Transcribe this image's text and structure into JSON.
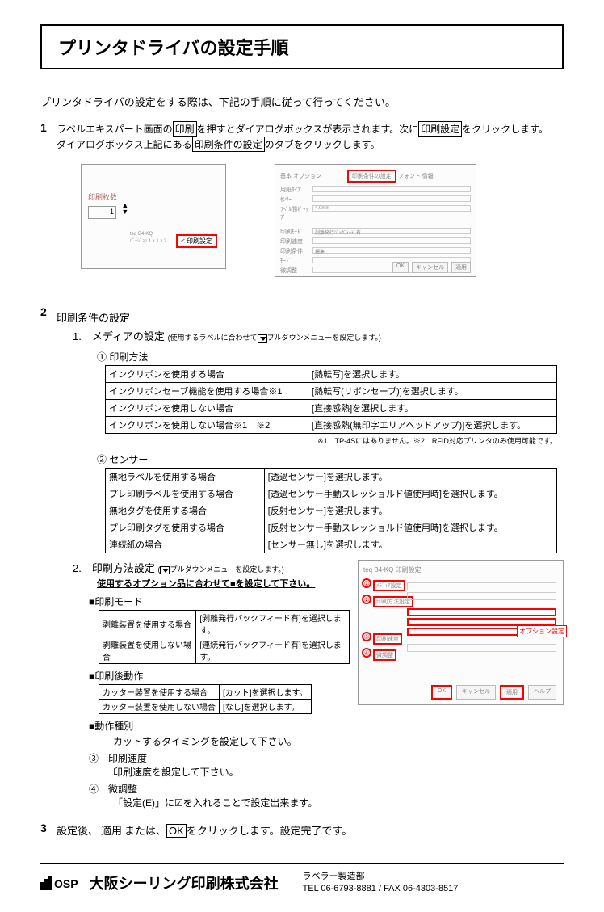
{
  "title": "プリンタドライバの設定手順",
  "intro": "プリンタドライバの設定をする際は、下記の手順に従って行ってください。",
  "step1": {
    "num": "1",
    "t1a": "ラベルエキスパート画面の",
    "t1b": "印刷",
    "t1c": "を押すとダイアログボックスが表示されます。次に",
    "t1d": "印刷設定",
    "t1e": "をクリックします。",
    "t2a": "ダイアログボックス上記にある",
    "t2b": "印刷条件の設定",
    "t2c": "のタブをクリックします。"
  },
  "shot_left": {
    "label": "印刷枚数",
    "value": "1",
    "btn": "< 印刷設定"
  },
  "shot_right": {
    "tab": "印刷条件の設定",
    "ok": "OK",
    "cancel": "キャンセル",
    "apply": "適用"
  },
  "step2": {
    "num": "2",
    "head": "印刷条件の設定",
    "sub1_head": "1.　メディアの設定",
    "sub1_note_a": "(使用するラベルに合わせて",
    "sub1_note_b": "プルダウンメニューを設定します。)",
    "c1": "① 印刷方法",
    "t1": [
      [
        "インクリボンを使用する場合",
        "[熱転写]を選択します。"
      ],
      [
        "インクリボンセーブ機能を使用する場合※1",
        "[熱転写(リボンセーブ)]を選択します。"
      ],
      [
        "インクリボンを使用しない場合",
        "[直接感熱]を選択します。"
      ],
      [
        "インクリボンを使用しない場合※1　※2",
        "[直接感熱(無印字エリアヘッドアップ)]を選択します。"
      ]
    ],
    "t1_note": "※1　TP-4Sにはありません。※2　RFID対応プリンタのみ使用可能です。",
    "c2": "② センサー",
    "t2": [
      [
        "無地ラベルを使用する場合",
        "[透過センサー]を選択します。"
      ],
      [
        "プレ印刷ラベルを使用する場合",
        "[透過センサー手動スレッショルド値使用時]を選択します。"
      ],
      [
        "無地タグを使用する場合",
        "[反射センサー]を選択します。"
      ],
      [
        "プレ印刷タグを使用する場合",
        "[反射センサー手動スレッショルド値使用時]を選択します。"
      ],
      [
        "連続紙の場合",
        "[センサー無し]を選択します。"
      ]
    ],
    "sub2_head": "2.　印刷方法設定",
    "sub2_note_a": "(",
    "sub2_note_b": "プルダウンメニューを設定します。)",
    "sub2_under": "使用するオプション品に合わせて■を設定して下さい。",
    "mode_head": "■印刷モード",
    "mode_tbl": [
      [
        "剥離装置を使用する場合",
        "[剥離発行バックフィード有]を選択します。"
      ],
      [
        "剥離装置を使用しない場合",
        "[連続発行バックフィード有]を選択します。"
      ]
    ],
    "post_head": "■印刷後動作",
    "post_tbl": [
      [
        "カッター装置を使用する場合",
        "[カット]を選択します。"
      ],
      [
        "カッター装置を使用しない場合",
        "[なし]を選択します。"
      ]
    ],
    "action_head": "■動作種別",
    "action_txt": "カットするタイミングを設定して下さい。",
    "c3": "③　印刷速度",
    "c3_txt": "印刷速度を設定して下さい。",
    "c4": "④　微調整",
    "c4_txt": "「設定(E)」に☑を入れることで設定出来ます。"
  },
  "shot3": {
    "title": "teq B4-KQ 印刷設定",
    "opt_label": "オプション設定",
    "n1": "①",
    "n2": "②",
    "n3": "③",
    "n4": "④",
    "ok": "OK",
    "cancel": "キャンセル",
    "apply": "適用",
    "help": "ヘルプ"
  },
  "step3": {
    "num": "3",
    "a": "設定後、",
    "b": "適用",
    "c": "または、",
    "d": "OK",
    "e": "をクリックします。設定完了です。"
  },
  "footer": {
    "logo": "OSP",
    "company": "大阪シーリング印刷株式会社",
    "dept": "ラベラー製造部",
    "contact": "TEL 06-6793-8881 / FAX 06-4303-8517"
  }
}
